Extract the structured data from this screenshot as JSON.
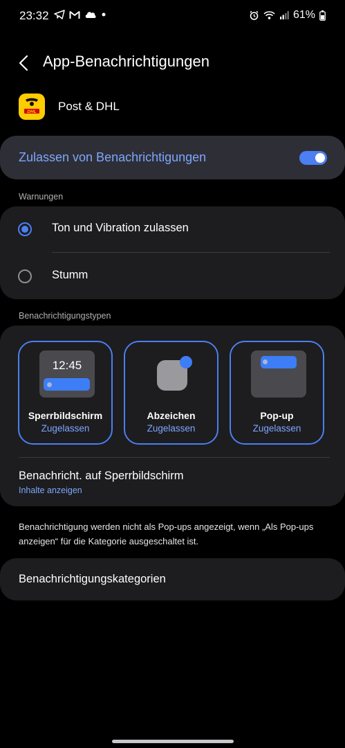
{
  "status_bar": {
    "time": "23:32",
    "battery": "61%",
    "left_icons": [
      "telegram-icon",
      "gmail-icon",
      "cloud-icon",
      "dot-icon"
    ],
    "right_icons": [
      "alarm-icon",
      "wifi-icon",
      "signal-icon",
      "battery-icon"
    ]
  },
  "header": {
    "title": "App-Benachrichtigungen"
  },
  "app": {
    "name": "Post & DHL",
    "icon_text": "DHL"
  },
  "allow": {
    "label": "Zulassen von Benachrichtigungen",
    "enabled": true
  },
  "warnings": {
    "section_label": "Warnungen",
    "options": [
      {
        "label": "Ton und Vibration zulassen",
        "selected": true
      },
      {
        "label": "Stumm",
        "selected": false
      }
    ]
  },
  "types": {
    "section_label": "Benachrichtigungstypen",
    "items": [
      {
        "name": "Sperrbildschirm",
        "status": "Zugelassen",
        "preview_clock": "12:45"
      },
      {
        "name": "Abzeichen",
        "status": "Zugelassen"
      },
      {
        "name": "Pop-up",
        "status": "Zugelassen"
      }
    ],
    "lockscreen": {
      "title": "Benachricht. auf Sperrbildschirm",
      "subtitle": "Inhalte anzeigen"
    }
  },
  "note": "Benachrichtigung werden nicht als Pop-ups angezeigt, wenn „Als Pop-ups anzeigen“ für die Kategorie ausgeschaltet ist.",
  "categories": {
    "label": "Benachrichtigungskategorien"
  },
  "colors": {
    "accent": "#4b7ff2",
    "accent_text": "#7ea6ff",
    "card": "#1d1d1f",
    "background": "#000000",
    "app_icon": "#ffcc00"
  }
}
